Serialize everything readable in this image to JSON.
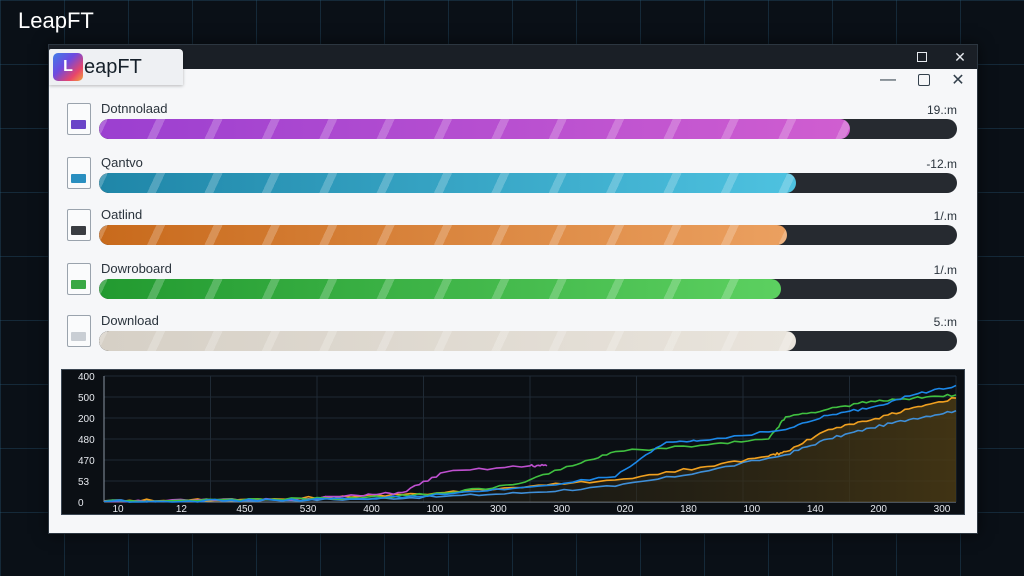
{
  "desktop": {
    "title": "LeapFT"
  },
  "window": {
    "app_name": "eapFT",
    "logo_letter": "L",
    "outer_controls": {
      "maximize": "maximize",
      "close": "✕"
    },
    "inner_controls": {
      "minimize": "—",
      "restore": "restore",
      "close": "✕"
    }
  },
  "downloads": [
    {
      "label": "Dotnnolaad",
      "size": "19.:m",
      "progress": 0.875,
      "color": "#9b3fd0",
      "color2": "#d05ed0",
      "icon_color": "#6b45c8"
    },
    {
      "label": "Qantvo",
      "size": "-12.m",
      "progress": 0.812,
      "color": "#1f86a8",
      "color2": "#4ec2e0",
      "icon_color": "#2a8fc0"
    },
    {
      "label": "Oatlind",
      "size": "1/.m",
      "progress": 0.802,
      "color": "#c86a1c",
      "color2": "#eba060",
      "icon_color": "#3a3d42"
    },
    {
      "label": "Dowroboard",
      "size": "1/.m",
      "progress": 0.795,
      "color": "#229a30",
      "color2": "#5cd060",
      "icon_color": "#39a845"
    },
    {
      "label": "Download",
      "size": "5.:m",
      "progress": 0.812,
      "color": "#d6d0c6",
      "color2": "#e9e4dc",
      "icon_color": "#c9ced4"
    }
  ],
  "chart_data": {
    "type": "line",
    "y_ticks": [
      "400",
      "500",
      "200",
      "480",
      "470",
      "53",
      "0"
    ],
    "x_ticks": [
      "10",
      "12",
      "450",
      "530",
      "400",
      "100",
      "300",
      "300",
      "020",
      "180",
      "100",
      "140",
      "200",
      "300"
    ],
    "ylim": [
      0,
      400
    ],
    "xlim": [
      0,
      100
    ],
    "grid": true,
    "series": [
      {
        "color": "#3f8fd8",
        "points": [
          [
            0,
            3
          ],
          [
            10,
            4
          ],
          [
            20,
            6
          ],
          [
            30,
            9
          ],
          [
            40,
            18
          ],
          [
            50,
            30
          ],
          [
            60,
            50
          ],
          [
            70,
            95
          ],
          [
            80,
            150
          ],
          [
            85,
            200
          ],
          [
            90,
            235
          ],
          [
            95,
            265
          ],
          [
            100,
            290
          ]
        ]
      },
      {
        "color": "#f0a020",
        "points": [
          [
            0,
            4
          ],
          [
            10,
            6
          ],
          [
            20,
            10
          ],
          [
            30,
            18
          ],
          [
            40,
            30
          ],
          [
            50,
            50
          ],
          [
            60,
            70
          ],
          [
            70,
            110
          ],
          [
            78,
            145
          ],
          [
            80,
            160
          ],
          [
            85,
            230
          ],
          [
            90,
            260
          ],
          [
            95,
            300
          ],
          [
            100,
            330
          ]
        ]
      },
      {
        "color": "#c050d0",
        "points": [
          [
            0,
            3
          ],
          [
            10,
            5
          ],
          [
            20,
            8
          ],
          [
            30,
            20
          ],
          [
            35,
            30
          ],
          [
            40,
            95
          ],
          [
            50,
            115
          ],
          [
            52,
            115
          ]
        ]
      },
      {
        "color": "#40c040",
        "points": [
          [
            0,
            2
          ],
          [
            10,
            5
          ],
          [
            20,
            9
          ],
          [
            30,
            12
          ],
          [
            40,
            28
          ],
          [
            48,
            55
          ],
          [
            55,
            115
          ],
          [
            60,
            160
          ],
          [
            70,
            180
          ],
          [
            78,
            200
          ],
          [
            80,
            270
          ],
          [
            85,
            295
          ],
          [
            90,
            320
          ],
          [
            95,
            330
          ],
          [
            100,
            340
          ]
        ]
      },
      {
        "color": "#1c88e8",
        "points": [
          [
            0,
            2
          ],
          [
            10,
            3
          ],
          [
            20,
            6
          ],
          [
            30,
            10
          ],
          [
            40,
            24
          ],
          [
            50,
            48
          ],
          [
            60,
            80
          ],
          [
            66,
            190
          ],
          [
            70,
            195
          ],
          [
            80,
            230
          ],
          [
            85,
            275
          ],
          [
            90,
            300
          ],
          [
            95,
            340
          ],
          [
            100,
            370
          ]
        ]
      }
    ]
  }
}
